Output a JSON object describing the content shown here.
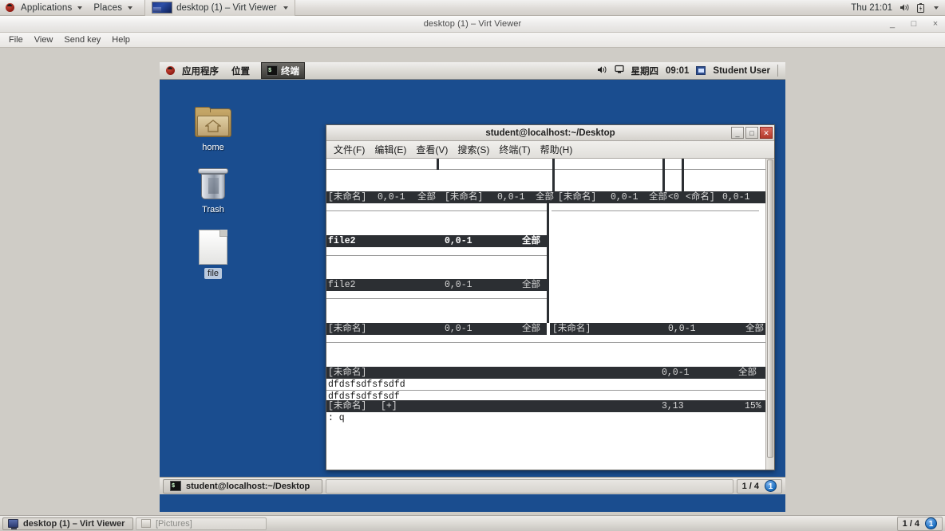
{
  "host": {
    "panel": {
      "applications": "Applications",
      "places": "Places",
      "window_button": "desktop (1) – Virt Viewer",
      "clock": "Thu 21:01",
      "volume_icon": "volume-icon",
      "battery_icon": "battery-icon"
    },
    "window": {
      "title": "desktop (1) – Virt Viewer",
      "minimize": "_",
      "maximize": "□",
      "close": "×",
      "menu": [
        "File",
        "View",
        "Send key",
        "Help"
      ]
    },
    "taskbar": {
      "items": [
        {
          "label": "desktop (1) – Virt Viewer",
          "icon": "monitor-icon",
          "active": true
        },
        {
          "label": "[Pictures]",
          "icon": "picture-icon",
          "active": false
        }
      ],
      "workspace": "1 / 4",
      "workspace_badge": "1"
    }
  },
  "guest": {
    "top_panel": {
      "applications": "应用程序",
      "places": "位置",
      "task_button": "终端",
      "task_icon": "terminal-icon",
      "volume_icon": "volume-icon",
      "display_icon": "display-icon",
      "day": "星期四",
      "clock": "09:01",
      "user": "Student User",
      "user_icon": "user-icon"
    },
    "desktop_icons": [
      {
        "label": "home",
        "icon": "home-folder-icon",
        "selected": false
      },
      {
        "label": "Trash",
        "icon": "trash-icon",
        "selected": false
      },
      {
        "label": "file",
        "icon": "file-document-icon",
        "selected": true
      }
    ],
    "taskbar": {
      "window_label": "student@localhost:~/Desktop",
      "window_icon": "terminal-icon",
      "workspace": "1 / 4",
      "workspace_badge": "1"
    }
  },
  "terminal": {
    "title": "student@localhost:~/Desktop",
    "buttons": {
      "minimize": "_",
      "maximize": "□",
      "close": "✕"
    },
    "menu": [
      "文件(F)",
      "编辑(E)",
      "查看(V)",
      "搜索(S)",
      "终端(T)",
      "帮助(H)"
    ],
    "tilde": "~",
    "vim": {
      "status_untitled": "[未命名]",
      "status_file2": "file2",
      "status_modified": "[+]",
      "pos_zero": "0,0-1",
      "pos_cursor": "3,13",
      "view_all": "全部",
      "view_pct": "15%",
      "trunc_left": "<0",
      "trunc_name": "<命名]",
      "rows": [
        {
          "status": [
            {
              "name": "[未命名]",
              "pos": "0,0-1",
              "view": "全部"
            },
            {
              "name": "[未命名]",
              "pos": "0,0-1",
              "view": "全部"
            },
            {
              "name": "[未命名]",
              "pos": "0,0-1",
              "view": "全部"
            },
            {
              "name": "<命名]",
              "pos": "0,0-1",
              "view": ""
            }
          ]
        },
        {
          "status": [
            {
              "name": "file2",
              "pos": "0,0-1",
              "view": "全部",
              "active": true
            },
            {
              "name": "[未命名]",
              "pos": "0,0-1",
              "view": "全部"
            }
          ]
        },
        {
          "status": [
            {
              "name": "file2",
              "pos": "0,0-1",
              "view": "全部"
            }
          ]
        },
        {
          "status": [
            {
              "name": "[未命名]",
              "pos": "0,0-1",
              "view": "全部"
            },
            {
              "name": "[未命名]",
              "pos": "0,0-1",
              "view": "全部"
            }
          ]
        },
        {
          "status": [
            {
              "name": "[未命名]",
              "pos": "0,0-1",
              "view": "全部"
            }
          ]
        }
      ],
      "buffer_lines": [
        "dfdsfsdfsfsdfd",
        "dfdsfsdfsfsdf"
      ],
      "last_status": {
        "name": "[未命名]",
        "modified": "[+]",
        "pos": "3,13",
        "view": "15%"
      },
      "command_line": ": q"
    }
  },
  "colors": {
    "desktop_blue": "#1a4d8f",
    "vim_status_bg": "#2c2f33",
    "panel_grey": "#dedcd7",
    "accent_blue": "#1a6ec0"
  }
}
